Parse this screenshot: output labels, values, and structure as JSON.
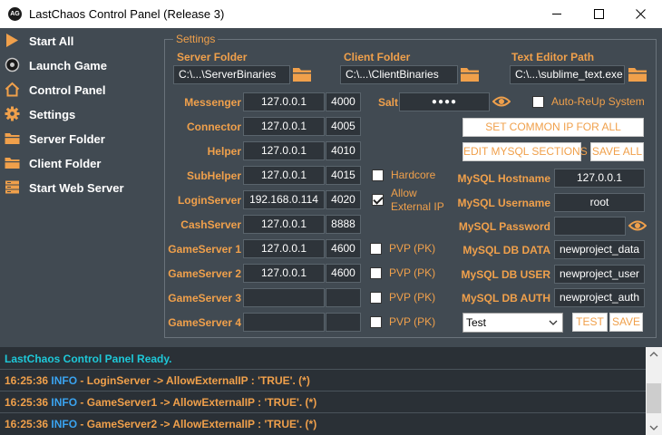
{
  "window": {
    "title": "LastChaos Control Panel (Release 3)",
    "icon_text": "AG",
    "icon_name": "app-logo-icon"
  },
  "colors": {
    "accent": "#f0a04b",
    "background": "#414a52",
    "field_bg": "#2e343a",
    "log_bg": "#2a3036",
    "cyan": "#1ec8d8",
    "info_blue": "#3aa3f0"
  },
  "sidebar": {
    "items": [
      {
        "label": "Start All",
        "icon": "play-icon"
      },
      {
        "label": "Launch Game",
        "icon": "game-disc-icon"
      },
      {
        "label": "Control Panel",
        "icon": "home-icon"
      },
      {
        "label": "Settings",
        "icon": "gear-icon"
      },
      {
        "label": "Server Folder",
        "icon": "folder-icon"
      },
      {
        "label": "Client Folder",
        "icon": "folder-icon"
      },
      {
        "label": "Start Web Server",
        "icon": "server-icon"
      }
    ]
  },
  "settings": {
    "title": "Settings",
    "server_folder": {
      "label": "Server Folder",
      "value": "C:\\...\\ServerBinaries"
    },
    "client_folder": {
      "label": "Client Folder",
      "value": "C:\\...\\ClientBinaries"
    },
    "text_editor": {
      "label": "Text Editor Path",
      "value": "C:\\...\\sublime_text.exe"
    },
    "servers": [
      {
        "label": "Messenger",
        "ip": "127.0.0.1",
        "port": "4000"
      },
      {
        "label": "Connector",
        "ip": "127.0.0.1",
        "port": "4005"
      },
      {
        "label": "Helper",
        "ip": "127.0.0.1",
        "port": "4010"
      },
      {
        "label": "SubHelper",
        "ip": "127.0.0.1",
        "port": "4015"
      },
      {
        "label": "LoginServer",
        "ip": "192.168.0.114",
        "port": "4020"
      },
      {
        "label": "CashServer",
        "ip": "127.0.0.1",
        "port": "8888"
      },
      {
        "label": "GameServer 1",
        "ip": "127.0.0.1",
        "port": "4600"
      },
      {
        "label": "GameServer 2",
        "ip": "127.0.0.1",
        "port": "4600"
      },
      {
        "label": "GameServer 3",
        "ip": "",
        "port": ""
      },
      {
        "label": "GameServer 4",
        "ip": "",
        "port": ""
      }
    ],
    "salt": {
      "label": "Salt",
      "value": "●●●●"
    },
    "auto_reup": {
      "label": "Auto-ReUp System",
      "checked": false
    },
    "hardcore": {
      "label": "Hardcore",
      "checked": false
    },
    "allow_external": {
      "label_line1": "Allow",
      "label_line2": "External IP",
      "checked": true
    },
    "pvp": [
      {
        "label": "PVP (PK)",
        "checked": false
      },
      {
        "label": "PVP (PK)",
        "checked": false
      },
      {
        "label": "PVP (PK)",
        "checked": false
      },
      {
        "label": "PVP (PK)",
        "checked": false
      }
    ],
    "buttons": {
      "set_common_ip": "SET COMMON IP FOR ALL",
      "edit_mysql": "EDIT MYSQL SECTIONS",
      "save_all": "SAVE ALL",
      "test": "TEST",
      "save": "SAVE"
    },
    "mysql": {
      "hostname": {
        "label": "MySQL Hostname",
        "value": "127.0.0.1"
      },
      "username": {
        "label": "MySQL Username",
        "value": "root"
      },
      "password": {
        "label": "MySQL Password",
        "value": ""
      },
      "db_data": {
        "label": "MySQL DB DATA",
        "value": "newproject_data"
      },
      "db_user": {
        "label": "MySQL DB USER",
        "value": "newproject_user"
      },
      "db_auth": {
        "label": "MySQL DB AUTH",
        "value": "newproject_auth"
      }
    },
    "profile_select": {
      "value": "Test"
    }
  },
  "log": {
    "ready": "LastChaos Control Panel Ready.",
    "entries": [
      {
        "time": "16:25:36",
        "level": "INFO",
        "message": "- LoginServer -> AllowExternalIP : 'TRUE'. (*)"
      },
      {
        "time": "16:25:36",
        "level": "INFO",
        "message": "- GameServer1 -> AllowExternalIP : 'TRUE'. (*)"
      },
      {
        "time": "16:25:36",
        "level": "INFO",
        "message": "- GameServer2 -> AllowExternalIP : 'TRUE'. (*)"
      }
    ]
  }
}
